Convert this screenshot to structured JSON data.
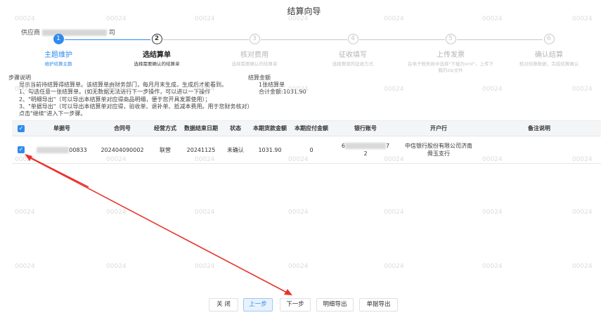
{
  "page": {
    "title": "结算向导"
  },
  "supplier": {
    "prefix": "供应商",
    "suffix": "司"
  },
  "steps": [
    {
      "num": "1",
      "label": "主题维护",
      "desc": "维护结算主题",
      "state": "done"
    },
    {
      "num": "2",
      "label": "选结算单",
      "desc": "选择需要确认的结算单",
      "state": "active"
    },
    {
      "num": "3",
      "label": "核对费用",
      "desc": "选择需要确认的结算单",
      "state": "pending"
    },
    {
      "num": "4",
      "label": "征收填写",
      "desc": "选择费用的征收方式",
      "state": "pending"
    },
    {
      "num": "5",
      "label": "上传发票",
      "desc": "在电子税务局中选择\"下载为xml\"，上传下载的zip文件",
      "state": "pending"
    },
    {
      "num": "6",
      "label": "确认结算",
      "desc": "核对结算数据，完成结算确认",
      "state": "pending"
    }
  ],
  "instructions": {
    "heading": "步骤说明",
    "lines": [
      "显示当前待结算得结算单。该结算单由财务部门，每月月末生成，生成后才能看到。",
      "1、勾选任意一张结算单。(如无数据无法进行下一步操作，可以进以一下操作",
      "2、\"明细导出\"（可以导出本结算单对应得商品明细，便于您开具发票使用）；",
      "3、\"单据导出\"（可以导出本结算单对应得，验收单、退补单、抵减本费用。用于您财务核对）",
      "点击\"继续\"进入下一步骤。"
    ]
  },
  "summary": {
    "heading": "结算金额",
    "count": "1张结算单",
    "total": "合计金额:1031.90"
  },
  "table": {
    "headers": [
      "单据号",
      "合同号",
      "经营方式",
      "数据结束日期",
      "状态",
      "本期货款金额",
      "本期应付金额",
      "银行账号",
      "开户行",
      "备注说明"
    ],
    "row": {
      "doc_no_suffix": "00833",
      "contract_no": "202404090002",
      "mode": "联营",
      "end_date": "20241125",
      "status": "未确认",
      "goods_amount": "1031.90",
      "payable_amount": "0",
      "bank_account_head": "6",
      "bank_account_tail": "7",
      "bank_account_line2": "2",
      "bank_name_line1": "中信银行股份有限公司济南",
      "bank_name_line2": "舜玉支行",
      "remark": ""
    }
  },
  "watermark_text": "00024",
  "buttons": {
    "close": "关 闭",
    "prev": "上一步",
    "next": "下一步",
    "detail_export": "明细导出",
    "doc_export": "单据导出"
  },
  "colors": {
    "accent": "#2f8bee",
    "annotation_arrow": "#e8332c"
  }
}
